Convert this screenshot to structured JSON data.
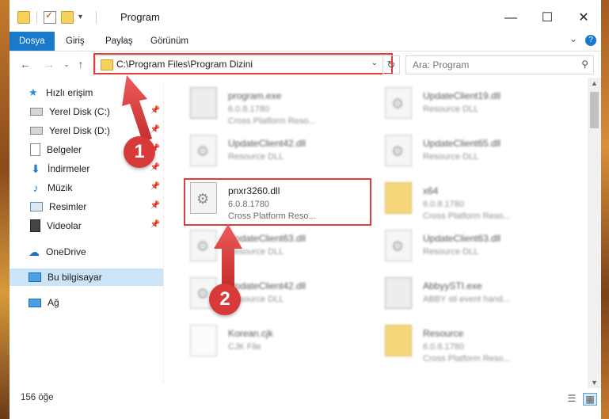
{
  "window": {
    "title": "Program",
    "controls": {
      "minimize": "—",
      "maximize": "☐",
      "close": "✕"
    }
  },
  "ribbon": {
    "tabs": [
      {
        "label": "Dosya",
        "active": true
      },
      {
        "label": "Giriş"
      },
      {
        "label": "Paylaş"
      },
      {
        "label": "Görünüm"
      }
    ]
  },
  "nav": {
    "address": "C:\\Program Files\\Program Dizini",
    "search_placeholder": "Ara: Program"
  },
  "sidebar": {
    "items": [
      {
        "label": "Hızlı erişim",
        "icon": "star-icon"
      },
      {
        "label": "Yerel Disk (C:)",
        "icon": "drive-icon",
        "pinned": true
      },
      {
        "label": "Yerel Disk (D:)",
        "icon": "drive-icon",
        "pinned": true
      },
      {
        "label": "Belgeler",
        "icon": "documents-icon",
        "pinned": true
      },
      {
        "label": "İndirmeler",
        "icon": "download-icon",
        "pinned": true
      },
      {
        "label": "Müzik",
        "icon": "music-icon",
        "pinned": true
      },
      {
        "label": "Resimler",
        "icon": "pictures-icon",
        "pinned": true
      },
      {
        "label": "Videolar",
        "icon": "videos-icon",
        "pinned": true
      },
      {
        "label": "OneDrive",
        "icon": "cloud-icon"
      },
      {
        "label": "Bu bilgisayar",
        "icon": "computer-icon",
        "selected": true
      },
      {
        "label": "Ağ",
        "icon": "network-icon"
      }
    ]
  },
  "files": [
    {
      "name": "program.exe",
      "line2": "6.0.8.1780",
      "line3": "Cross Platform Reso...",
      "icon": "exe-icon",
      "blurred": true
    },
    {
      "name": "UpdateClient19.dll",
      "line2": "Resource DLL",
      "line3": "",
      "icon": "dll-icon",
      "blurred": true
    },
    {
      "name": "UpdateClient42.dll",
      "line2": "Resource DLL",
      "line3": "",
      "icon": "dll-icon",
      "blurred": true
    },
    {
      "name": "UpdateClient65.dll",
      "line2": "Resource DLL",
      "line3": "",
      "icon": "dll-icon",
      "blurred": true
    },
    {
      "name": "pnxr3260.dll",
      "line2": "6.0.8.1780",
      "line3": "Cross Platform Reso...",
      "icon": "dll-icon",
      "blurred": false,
      "highlighted": true
    },
    {
      "name": "x64",
      "line2": "6.0.8.1780",
      "line3": "Cross Platform Reso...",
      "icon": "folder-icon",
      "blurred": true
    },
    {
      "name": "UpdateClient63.dll",
      "line2": "Resource DLL",
      "line3": "",
      "icon": "dll-icon",
      "blurred": true
    },
    {
      "name": "UpdateClient63.dll",
      "line2": "Resource DLL",
      "line3": "",
      "icon": "dll-icon",
      "blurred": true
    },
    {
      "name": "UpdateClient42.dll",
      "line2": "Resource DLL",
      "line3": "",
      "icon": "dll-icon",
      "blurred": true
    },
    {
      "name": "AbbyySTI.exe",
      "line2": "ABBY sti event hand...",
      "line3": "",
      "icon": "exe-icon",
      "blurred": true
    },
    {
      "name": "Korean.cjk",
      "line2": "CJK File",
      "line3": "",
      "icon": "file-icon",
      "blurred": true
    },
    {
      "name": "Resource",
      "line2": "6.0.8.1780",
      "line3": "Cross Platform Reso...",
      "icon": "folder-icon",
      "blurred": true
    }
  ],
  "status": {
    "count": "156 öğe"
  },
  "annotations": {
    "badge1": "1",
    "badge2": "2"
  },
  "colors": {
    "accent": "#1979ca",
    "highlight": "#e23b3b",
    "selected": "#cce4f7"
  }
}
